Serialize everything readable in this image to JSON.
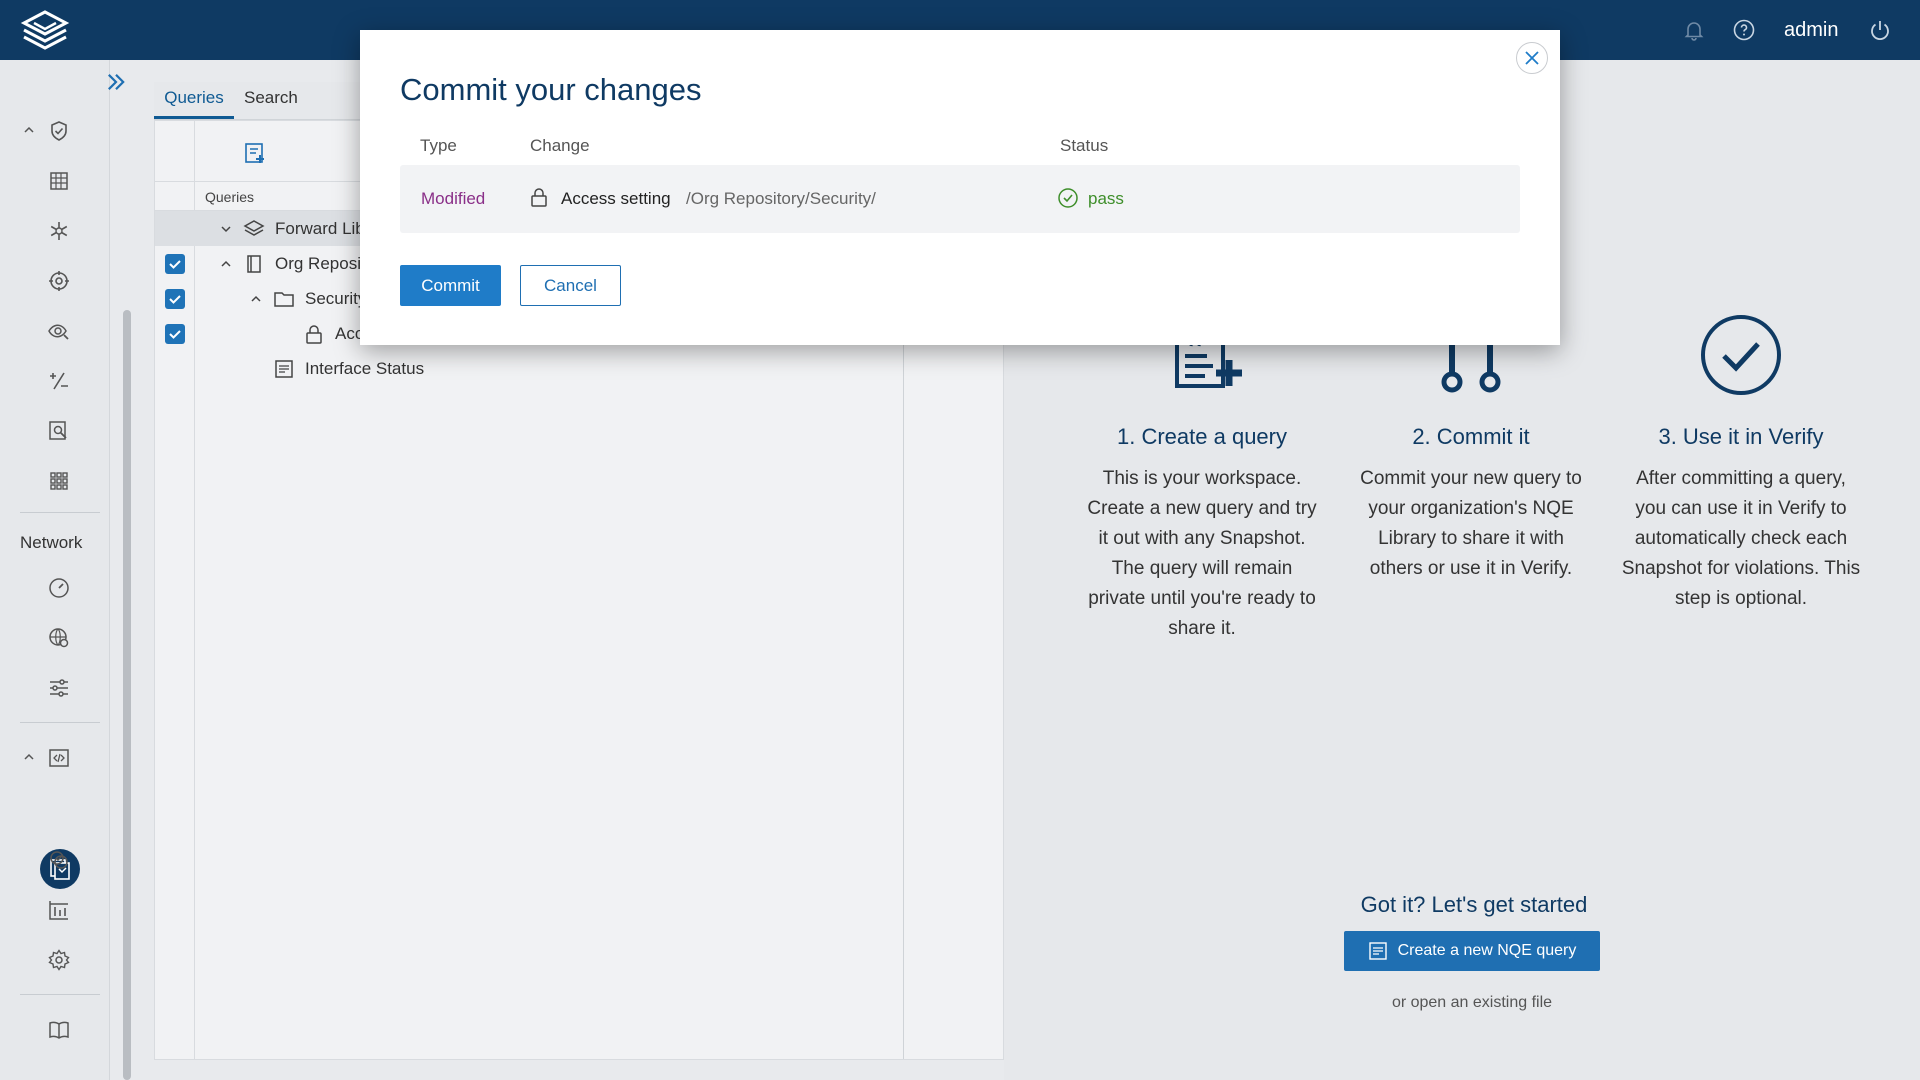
{
  "topbar": {
    "logo_icon": "layers-logo-icon",
    "notifications_icon": "bell-icon",
    "help_icon": "help-circle-icon",
    "user_label": "admin",
    "logout_icon": "power-icon",
    "background": "#0f3a63"
  },
  "rail": {
    "expand_icon": "double-chevron-right-icon",
    "section_label": "Network",
    "icons": [
      "shield-check-icon",
      "grid-icon",
      "snowflake-icon",
      "settings-cog-icon",
      "eye-search-icon",
      "plus-minus-icon",
      "search-document-icon",
      "apps-grid-icon",
      "dashboard-gauge-icon",
      "globe-settings-icon",
      "sliders-icon",
      "code-file-icon",
      "nqe-library-icon",
      "verify-icon",
      "chart-icon",
      "gear-icon",
      "book-icon"
    ]
  },
  "library": {
    "tabs": [
      {
        "label": "Queries",
        "active": true
      },
      {
        "label": "Search",
        "active": false
      }
    ],
    "column_header": "Queries",
    "tree": [
      {
        "label": "Forward Library",
        "icon": "layers-icon",
        "checked": false,
        "expanded": true
      },
      {
        "label": "Org Repository",
        "icon": "book-icon",
        "checked": true,
        "expanded": true
      },
      {
        "label": "Security",
        "icon": "folder-icon",
        "checked": true,
        "expanded": true
      },
      {
        "label": "Access setting",
        "icon": "lock-icon",
        "checked": true
      },
      {
        "label": "Interface Status",
        "icon": "query-file-icon",
        "checked": false
      }
    ]
  },
  "onboarding": {
    "steps": [
      {
        "title": "1. Create a query",
        "text": "This is your workspace. Create a new query and try it out with any Snapshot. The query will remain private until you're ready to share it.",
        "icon": "new-query-icon"
      },
      {
        "title": "2. Commit it",
        "text": "Commit your new query to your organization's NQE Library to share it with others or use it in Verify.",
        "icon": "commit-icon"
      },
      {
        "title": "3. Use it in Verify",
        "text": "After committing a query, you can use it in Verify to automatically check each Snapshot for violations. This step is optional.",
        "icon": "check-circle-icon"
      }
    ],
    "got_it": "Got it? Let's get started",
    "create_button": "Create a new NQE query",
    "open_link": "or open an existing file"
  },
  "modal": {
    "title": "Commit your changes",
    "columns": {
      "type": "Type",
      "change": "Change",
      "status": "Status"
    },
    "row": {
      "type": "Modified",
      "name": "Access setting",
      "path": "/Org Repository/Security/",
      "status": "pass"
    },
    "commit_label": "Commit",
    "cancel_label": "Cancel",
    "close_icon": "close-icon",
    "accent": "#1f7cc8",
    "modified_color": "#8a2f88",
    "pass_color": "#3e8e2a"
  }
}
